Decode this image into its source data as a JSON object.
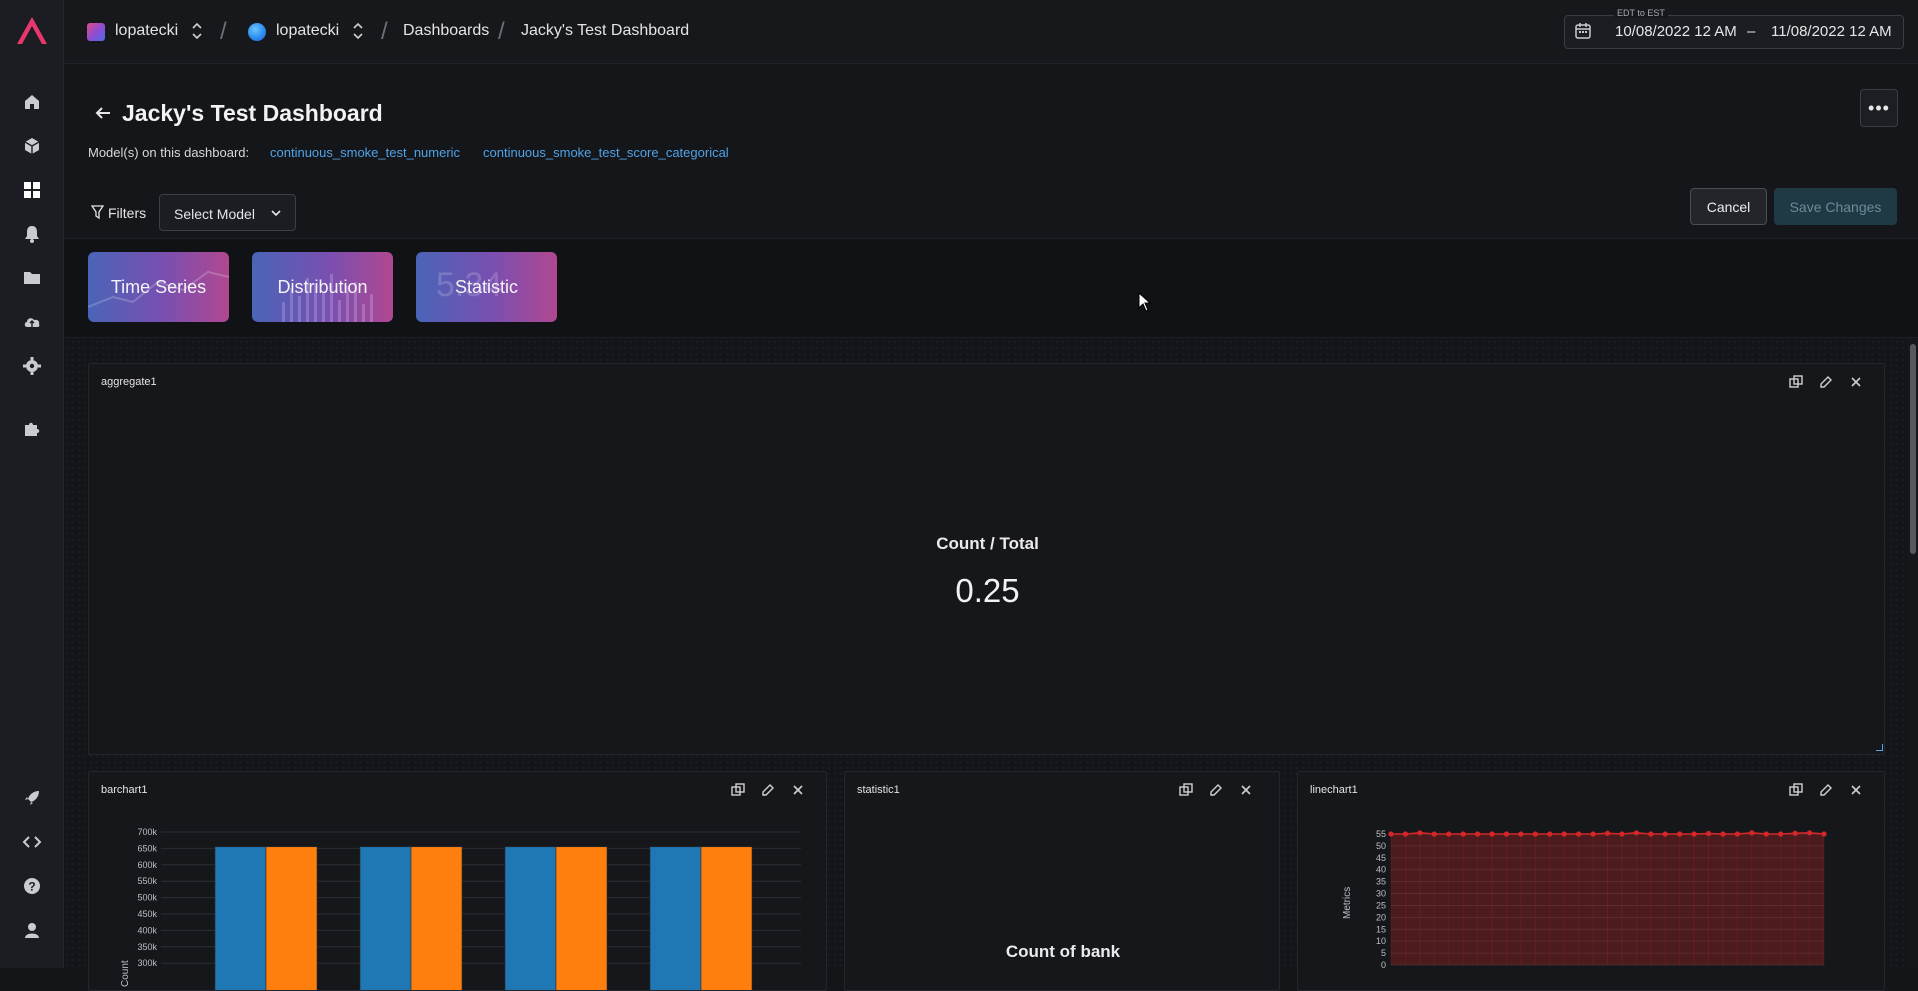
{
  "nav": {
    "org": "lopatecki",
    "space": "lopatecki",
    "crumb_dashboards": "Dashboards",
    "crumb_current": "Jacky's Test Dashboard"
  },
  "daterange": {
    "timezone_label": "EDT to EST",
    "start": "10/08/2022 12 AM",
    "separator": "–",
    "end": "11/08/2022 12 AM"
  },
  "sidebar_icons": [
    "home-icon",
    "cube-icon",
    "dashboard-icon",
    "bell-icon",
    "folder-icon",
    "cloud-upload-icon",
    "settings-icon",
    "puzzle-icon",
    "rocket-icon",
    "code-icon",
    "help-icon",
    "user-icon"
  ],
  "header": {
    "title": "Jacky's Test Dashboard",
    "models_label": "Model(s) on this dashboard:",
    "models": [
      "continuous_smoke_test_numeric",
      "continuous_smoke_test_score_categorical"
    ],
    "more_label": "•••"
  },
  "toolbar": {
    "filters_label": "Filters",
    "select_model": "Select Model",
    "cancel": "Cancel",
    "save": "Save Changes"
  },
  "widget_tiles": [
    "Time Series",
    "Distribution",
    "Statistic"
  ],
  "widget_tile_statistic_ghost": "5.34",
  "panels": {
    "aggregate": {
      "title": "aggregate1",
      "label": "Count / Total",
      "value": "0.25"
    },
    "barchart": {
      "title": "barchart1"
    },
    "statistic": {
      "title": "statistic1",
      "label": "Count of bank"
    },
    "linechart": {
      "title": "linechart1"
    }
  },
  "colors": {
    "accent": "#4fa3e8",
    "logo": "#e8386b",
    "bar_series_1": "#1f77b4",
    "bar_series_2": "#ff7f0e",
    "line_series": "#d62728"
  },
  "chart_data": [
    {
      "type": "bar",
      "ylabel": "Count",
      "ylim": [
        300000,
        700000
      ],
      "yticks": [
        "300k",
        "350k",
        "400k",
        "450k",
        "500k",
        "550k",
        "600k",
        "650k",
        "700k"
      ],
      "categories": [
        "",
        "",
        "",
        ""
      ],
      "series": [
        {
          "values": [
            655000,
            655000,
            655000,
            655000
          ]
        },
        {
          "values": [
            655000,
            655000,
            655000,
            655000
          ]
        }
      ],
      "grid": true
    },
    {
      "type": "area",
      "ylabel": "Metrics",
      "ylim": [
        0,
        55
      ],
      "yticks": [
        "0",
        "5",
        "10",
        "15",
        "20",
        "25",
        "30",
        "35",
        "40",
        "45",
        "50",
        "55"
      ],
      "series": [
        {
          "values": [
            55,
            55,
            55.5,
            55,
            55,
            55,
            55,
            55,
            55,
            55,
            55,
            55,
            55,
            55,
            55,
            55.3,
            55,
            55.5,
            55,
            55,
            55,
            55,
            55.2,
            55,
            55,
            55.5,
            55,
            55,
            55.3,
            55.5,
            55
          ]
        }
      ],
      "grid": true
    }
  ]
}
